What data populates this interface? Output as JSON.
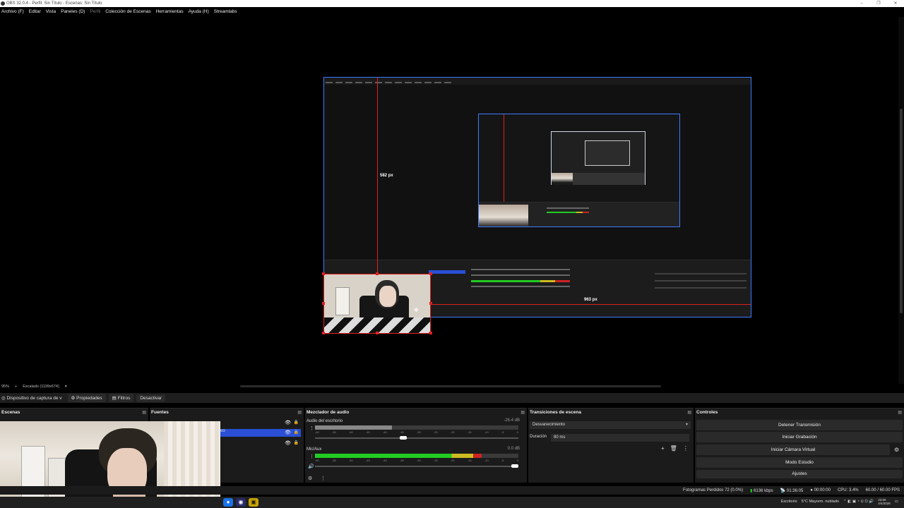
{
  "window": {
    "title": "OBS 32.0.4 - Perfil: Sin Título - Escenas: Sin Título"
  },
  "menu": [
    {
      "label": "Archivo (F)",
      "dim": false
    },
    {
      "label": "Editar",
      "dim": false
    },
    {
      "label": "Vista",
      "dim": false
    },
    {
      "label": "Paneles (D)",
      "dim": false
    },
    {
      "label": "Perfil",
      "dim": true
    },
    {
      "label": "Colección de Escenas",
      "dim": false
    },
    {
      "label": "Herramientas",
      "dim": false
    },
    {
      "label": "Ayuda (H)",
      "dim": false
    },
    {
      "label": "Streamlabs",
      "dim": false
    }
  ],
  "preview": {
    "measure_vertical": "582 px",
    "measure_horizontal": "963 px"
  },
  "zoom": {
    "percent": "95%",
    "scale": "Escalado (1199x674)"
  },
  "toolbar": {
    "source_name": "Dispositivo de captura de v",
    "properties": "Propiedades",
    "filters": "Filtros",
    "deactivate": "Desactivar"
  },
  "docks": {
    "scenes": "Escenas",
    "sources": "Fuentes",
    "mixer": "Mezclador de audio",
    "transitions": "Transiciones de escena",
    "controls": "Controles"
  },
  "sources": [
    {
      "label": ""
    },
    {
      "label": "eo",
      "selected": true
    },
    {
      "label": ""
    }
  ],
  "mixer": {
    "channels": [
      {
        "name": "Audio del escritorio",
        "db": "-26.4 dB",
        "ticks": [
          "-60",
          "-55",
          "-50",
          "-45",
          "-40",
          "-35",
          "-30",
          "-25",
          "-20",
          "-15",
          "-10",
          "-5",
          "0"
        ],
        "volume": 0.43
      },
      {
        "name": "Mic/Aux",
        "db": "0.0 dB",
        "ticks": [
          "-60",
          "-55",
          "-50",
          "-45",
          "-40",
          "-35",
          "-30",
          "-25",
          "-20",
          "-15",
          "-10",
          "-5",
          "0"
        ],
        "volume": 1.0
      }
    ]
  },
  "transitions": {
    "selected": "Desvanecimiento",
    "duration_label": "Duración",
    "duration_value": "80 ms"
  },
  "controls": [
    "Detener Transmisión",
    "Iniciar Grabación",
    "Iniciar Cámara Virtual",
    "Modo Estudio",
    "Ajustes"
  ],
  "status": {
    "dropped": "Fotogramas Perdidos 72 (0.0%)",
    "bitrate": "6136 kbps",
    "live_time": "01:36:05",
    "rec_time": "00:00:00",
    "cpu": "CPU: 3.4%",
    "fps": "60.00 / 60.00 FPS"
  },
  "taskbar": {
    "desktop": "Escritorio",
    "weather": "5°C  Mayorm. nublado",
    "time": "23:06",
    "date": "4/4/2026"
  },
  "colors": {
    "accent_blue": "#3d7bff",
    "guide_red": "#e02020",
    "selection_blue": "#2a4fd6"
  }
}
